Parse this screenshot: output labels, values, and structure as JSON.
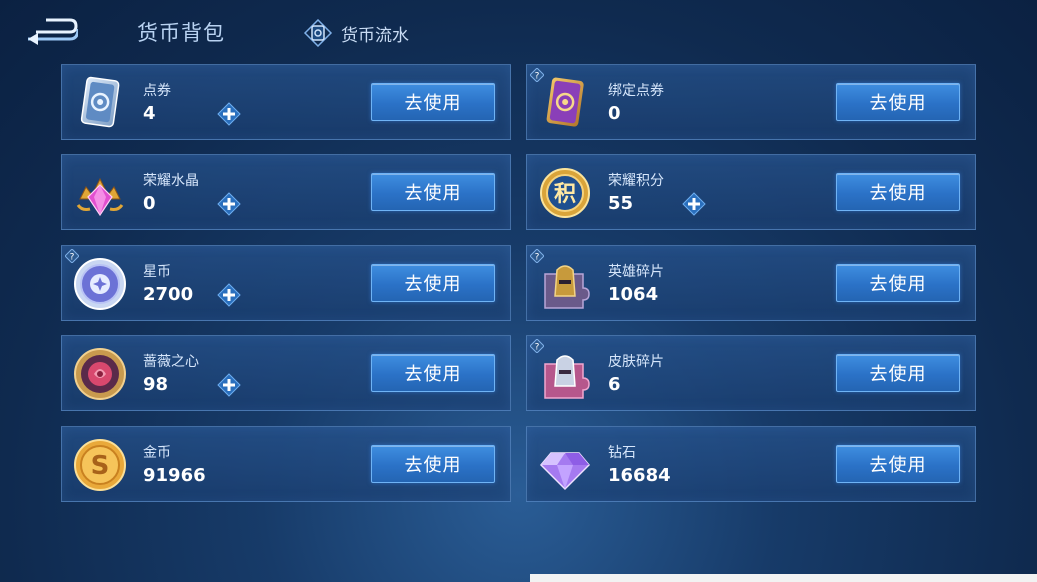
{
  "header": {
    "title": "货币背包",
    "flow_label": "货币流水"
  },
  "use_label": "去使用",
  "items": [
    {
      "name": "点券",
      "value": "4",
      "icon": "coupon-icon"
    },
    {
      "name": "绑定点券",
      "value": "0",
      "icon": "bound-coupon-icon"
    },
    {
      "name": "荣耀水晶",
      "value": "0",
      "icon": "glory-crystal-icon"
    },
    {
      "name": "荣耀积分",
      "value": "55",
      "icon": "glory-points-icon"
    },
    {
      "name": "星币",
      "value": "2700",
      "icon": "star-coin-icon"
    },
    {
      "name": "英雄碎片",
      "value": "1064",
      "icon": "hero-fragment-icon"
    },
    {
      "name": "蔷薇之心",
      "value": "98",
      "icon": "rose-heart-icon"
    },
    {
      "name": "皮肤碎片",
      "value": "6",
      "icon": "skin-fragment-icon"
    },
    {
      "name": "金币",
      "value": "91966",
      "icon": "gold-coin-icon"
    },
    {
      "name": "钻石",
      "value": "16684",
      "icon": "diamond-icon"
    }
  ],
  "glyphs": {
    "glory_points": "积",
    "gold_coin": "S"
  },
  "colors": {
    "button_blue": "#2b72c7",
    "card_border": "#78aae6",
    "text_light": "#d6e6fb"
  }
}
